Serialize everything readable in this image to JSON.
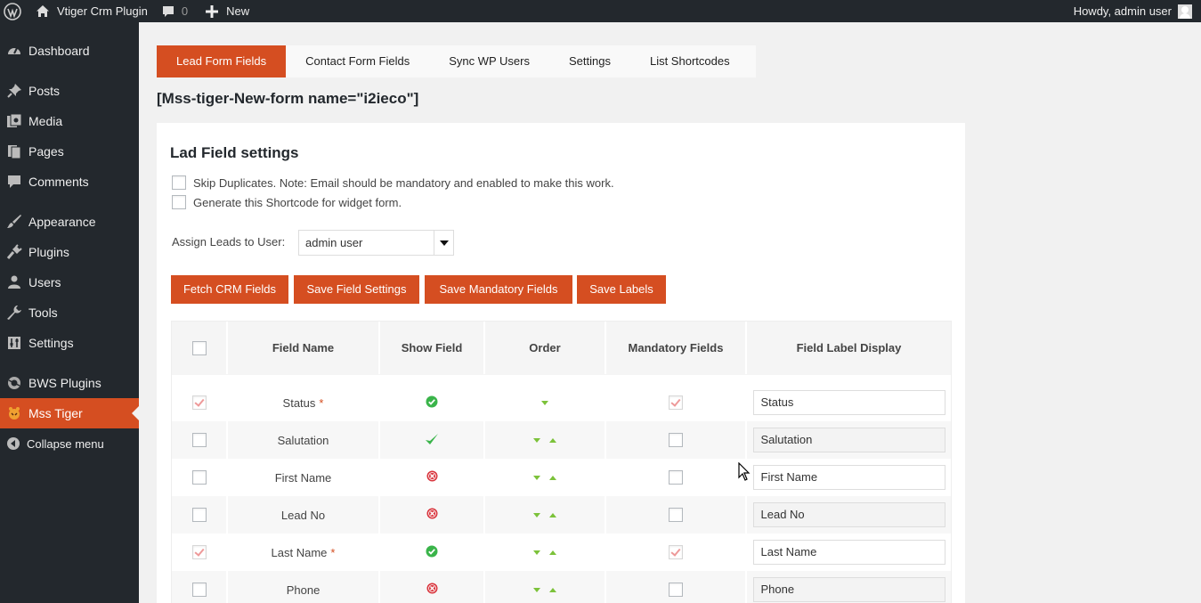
{
  "adminbar": {
    "site_name": "Vtiger Crm Plugin",
    "comments_count": "0",
    "new_label": "New",
    "howdy": "Howdy, admin user"
  },
  "menu": [
    {
      "label": "Dashboard",
      "icon": "dashboard-icon"
    },
    {
      "label": "Posts",
      "icon": "pin-icon"
    },
    {
      "label": "Media",
      "icon": "media-icon"
    },
    {
      "label": "Pages",
      "icon": "pages-icon"
    },
    {
      "label": "Comments",
      "icon": "comment-icon"
    },
    {
      "label": "Appearance",
      "icon": "brush-icon"
    },
    {
      "label": "Plugins",
      "icon": "plug-icon"
    },
    {
      "label": "Users",
      "icon": "user-icon"
    },
    {
      "label": "Tools",
      "icon": "wrench-icon"
    },
    {
      "label": "Settings",
      "icon": "sliders-icon"
    },
    {
      "label": "BWS Plugins",
      "icon": "bws-icon"
    },
    {
      "label": "Mss Tiger",
      "icon": "tiger-icon",
      "current": true
    },
    {
      "label": "Collapse menu",
      "icon": "collapse-icon"
    }
  ],
  "tabs": [
    "Lead Form Fields",
    "Contact Form Fields",
    "Sync WP Users",
    "Settings",
    "List Shortcodes"
  ],
  "shortcode": "[Mss-tiger-New-form name=\"i2ieco\"]",
  "panel": {
    "title": "Lad Field settings",
    "skip_duplicates": "Skip Duplicates. Note: Email should be mandatory and enabled to make this work.",
    "widget_shortcode": "Generate this Shortcode for widget form.",
    "assign_label": "Assign Leads to User:",
    "assign_value": "admin user",
    "buttons": [
      "Fetch CRM Fields",
      "Save Field Settings",
      "Save Mandatory Fields",
      "Save Labels"
    ]
  },
  "table": {
    "headers": [
      "Field Name",
      "Show Field",
      "Order",
      "Mandatory Fields",
      "Field Label Display"
    ],
    "rows": [
      {
        "name": "Status",
        "required": true,
        "show": "enabled",
        "order": "down",
        "mandatory": true,
        "label": "Status"
      },
      {
        "name": "Salutation",
        "required": false,
        "show": "check",
        "order": "both",
        "mandatory": false,
        "label": "Salutation"
      },
      {
        "name": "First Name",
        "required": false,
        "show": "disabled",
        "order": "both",
        "mandatory": false,
        "label": "First Name"
      },
      {
        "name": "Lead No",
        "required": false,
        "show": "disabled",
        "order": "both",
        "mandatory": false,
        "label": "Lead No"
      },
      {
        "name": "Last Name",
        "required": true,
        "show": "enabled",
        "order": "both",
        "mandatory": true,
        "label": "Last Name"
      },
      {
        "name": "Phone",
        "required": false,
        "show": "disabled",
        "order": "both",
        "mandatory": false,
        "label": "Phone"
      }
    ],
    "required_mark": "*"
  },
  "colors": {
    "accent": "#d54e21",
    "adminbar": "#23282d",
    "green": "#3ab44a",
    "red": "#d9363e"
  }
}
